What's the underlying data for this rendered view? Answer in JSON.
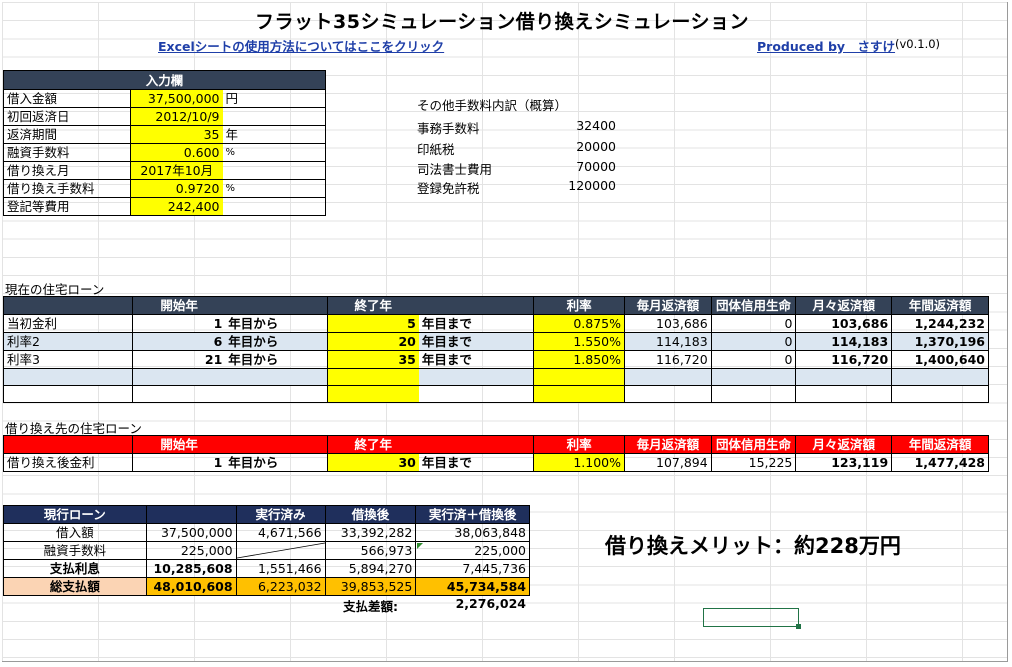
{
  "title": "フラット35シミュレーション借り換えシミュレーション",
  "help_link": "Excelシートの使用方法についてはここをクリック",
  "produced_by": "Produced by　さすけ",
  "version": "(v0.1.0)",
  "input": {
    "header": "入力欄",
    "rows": [
      {
        "label": "借入金額",
        "value": "37,500,000",
        "unit": "円"
      },
      {
        "label": "初回返済日",
        "value": "2012/10/9",
        "unit": ""
      },
      {
        "label": "返済期間",
        "value": "35",
        "unit": "年"
      },
      {
        "label": "融資手数料",
        "value": "0.600",
        "unit": "%"
      },
      {
        "label": "借り換え月",
        "value": "2017年10月",
        "unit": ""
      },
      {
        "label": "借り換え手数料",
        "value": "0.9720",
        "unit": "%"
      },
      {
        "label": "登記等費用",
        "value": "242,400",
        "unit": ""
      }
    ]
  },
  "fees": {
    "header": "その他手数料内訳（概算）",
    "rows": [
      {
        "label": "事務手数料",
        "value": "32400"
      },
      {
        "label": "印紙税",
        "value": "20000"
      },
      {
        "label": "司法書士費用",
        "value": "70000"
      },
      {
        "label": "登録免許税",
        "value": "120000"
      }
    ]
  },
  "current_loan": {
    "section_title": "現在の住宅ローン",
    "headers": [
      "",
      "開始年",
      "",
      "終了年",
      "",
      "利率",
      "毎月返済額",
      "団体信用生命",
      "月々返済額",
      "年間返済額"
    ],
    "rows": [
      {
        "name": "当初金利",
        "start": "1",
        "start_unit": "年目から",
        "end": "5",
        "end_unit": "年目まで",
        "rate": "0.875%",
        "monthly": "103,686",
        "group_life": "0",
        "monthly_total": "103,686",
        "annual": "1,244,232"
      },
      {
        "name": "利率2",
        "start": "6",
        "start_unit": "年目から",
        "end": "20",
        "end_unit": "年目まで",
        "rate": "1.550%",
        "monthly": "114,183",
        "group_life": "0",
        "monthly_total": "114,183",
        "annual": "1,370,196"
      },
      {
        "name": "利率3",
        "start": "21",
        "start_unit": "年目から",
        "end": "35",
        "end_unit": "年目まで",
        "rate": "1.850%",
        "monthly": "116,720",
        "group_life": "0",
        "monthly_total": "116,720",
        "annual": "1,400,640"
      }
    ]
  },
  "refi_loan": {
    "section_title": "借り換え先の住宅ローン",
    "headers": [
      "",
      "開始年",
      "",
      "終了年",
      "",
      "利率",
      "毎月返済額",
      "団体信用生命",
      "月々返済額",
      "年間返済額"
    ],
    "rows": [
      {
        "name": "借り換え後金利",
        "start": "1",
        "start_unit": "年目から",
        "end": "30",
        "end_unit": "年目まで",
        "rate": "1.100%",
        "monthly": "107,894",
        "group_life": "15,225",
        "monthly_total": "123,119",
        "annual": "1,477,428"
      }
    ]
  },
  "summary": {
    "headers": [
      "現行ローン",
      "",
      "実行済み",
      "借換後",
      "実行済＋借換後"
    ],
    "rows": [
      {
        "label": "借入額",
        "current": "37,500,000",
        "done": "4,671,566",
        "after": "33,392,282",
        "total": "38,063,848"
      },
      {
        "label": "融資手数料",
        "current": "225,000",
        "done": "",
        "after": "566,973",
        "total": "225,000"
      },
      {
        "label": "支払利息",
        "current": "10,285,608",
        "done": "1,551,466",
        "after": "5,894,270",
        "total": "7,445,736"
      },
      {
        "label": "総支払額",
        "current": "48,010,608",
        "done": "6,223,032",
        "after": "39,853,525",
        "total": "45,734,584"
      }
    ],
    "diff_label": "支払差額:",
    "diff_value": "2,276,024"
  },
  "merit": "借り換えメリット：約228万円"
}
